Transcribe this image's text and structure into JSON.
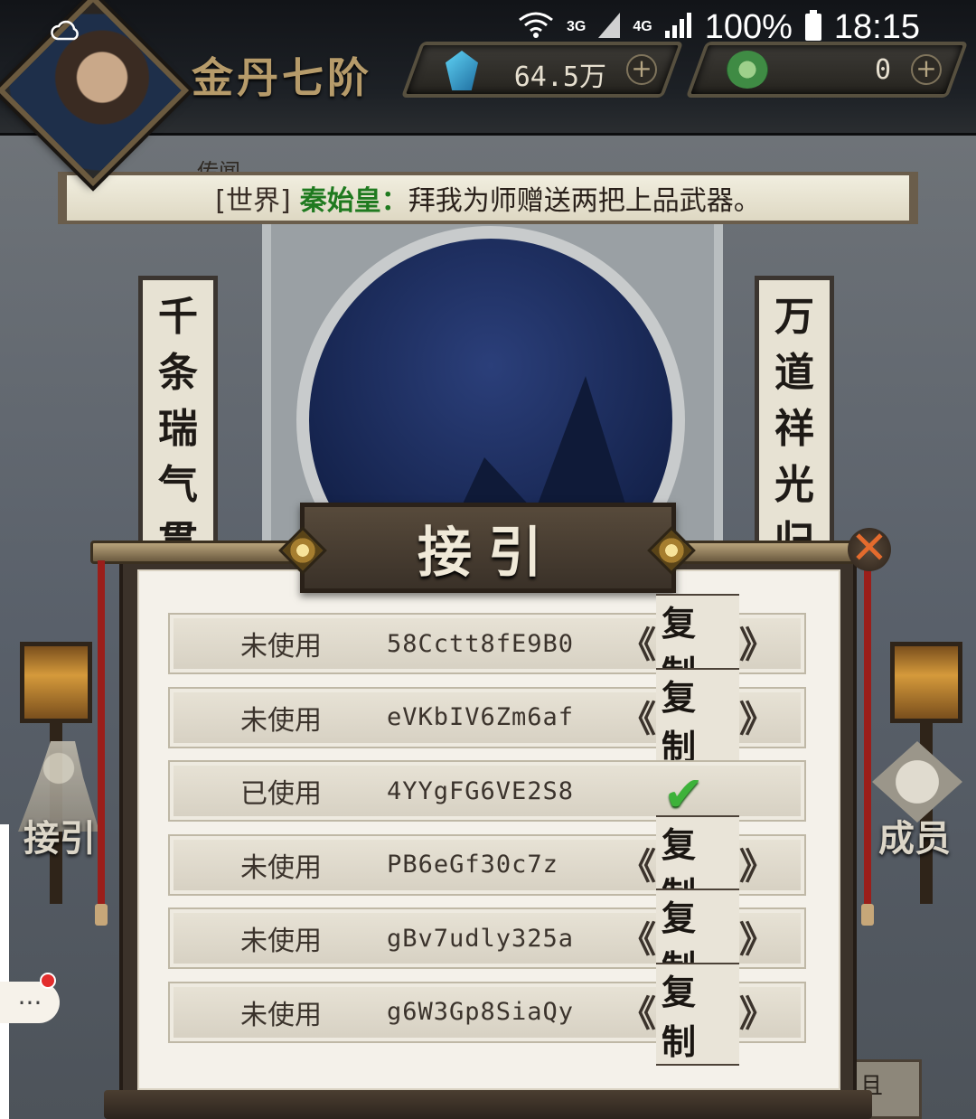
{
  "status_bar": {
    "network_3g": "3G",
    "network_4g": "4G",
    "battery": "100%",
    "time": "18:15"
  },
  "header": {
    "rank": "金丹七阶",
    "gems": "64.5万",
    "jade": "0"
  },
  "world_message": {
    "channel": "[世界]",
    "speaker": "秦始皇：",
    "text": "拜我为师赠送两把上品武器。"
  },
  "scene": {
    "small_label": "传闻",
    "left_couplet": [
      "千",
      "条",
      "瑞",
      "气",
      "贯"
    ],
    "right_couplet": [
      "万",
      "道",
      "祥",
      "光",
      "归"
    ],
    "left_side_button": "接引",
    "right_side_button": "成员",
    "bottom_right_partial": "且"
  },
  "dialog": {
    "title": "接引",
    "copy_label": "复制",
    "rows": [
      {
        "status": "未使用",
        "code": "58Cctt8fE9B0",
        "used": false
      },
      {
        "status": "未使用",
        "code": "eVKbIV6Zm6af",
        "used": false
      },
      {
        "status": "已使用",
        "code": "4YYgFG6VE2S8",
        "used": true
      },
      {
        "status": "未使用",
        "code": "PB6eGf30c7z",
        "used": false
      },
      {
        "status": "未使用",
        "code": "gBv7udly325a",
        "used": false
      },
      {
        "status": "未使用",
        "code": "g6W3Gp8SiaQy",
        "used": false
      }
    ]
  },
  "chat": {
    "bubble": "···"
  },
  "colors": {
    "accent_green": "#1f7a1f",
    "check_green": "#3db23a",
    "close_orange": "#e46b2d"
  }
}
